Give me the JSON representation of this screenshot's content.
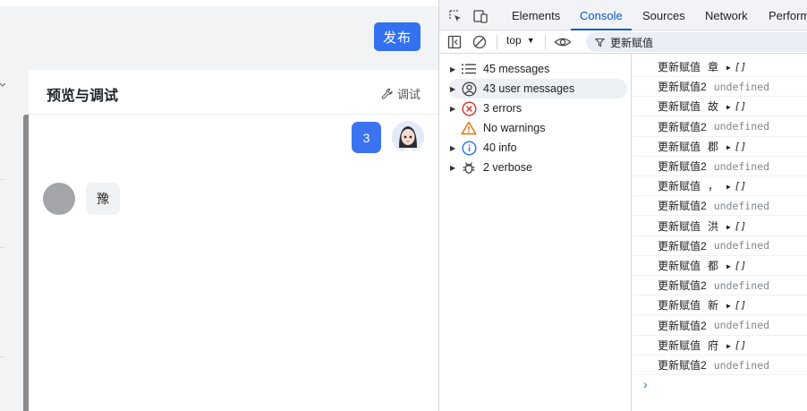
{
  "app": {
    "publish_label": "发布",
    "preview_title": "预览与调试",
    "debug_label": "调试",
    "user_message": "3",
    "bot_message": "豫"
  },
  "devtools": {
    "tabs": [
      "Elements",
      "Console",
      "Sources",
      "Network",
      "Perform"
    ],
    "active_tab": "Console",
    "context": "top",
    "filter_text": "更新赋值",
    "sidebar": [
      {
        "label": "45 messages",
        "icon": "list-icon",
        "expandable": true
      },
      {
        "label": "43 user messages",
        "icon": "user-circle-icon",
        "expandable": true,
        "selected": true
      },
      {
        "label": "3 errors",
        "icon": "error-icon",
        "expandable": true
      },
      {
        "label": "No warnings",
        "icon": "warning-icon",
        "expandable": false
      },
      {
        "label": "40 info",
        "icon": "info-icon",
        "expandable": true
      },
      {
        "label": "2 verbose",
        "icon": "bug-icon",
        "expandable": true
      }
    ],
    "logs": [
      {
        "label": "更新赋值",
        "char": "章",
        "value": "[]"
      },
      {
        "label": "更新赋值2",
        "value": "undefined"
      },
      {
        "label": "更新赋值",
        "char": "故",
        "value": "[]"
      },
      {
        "label": "更新赋值2",
        "value": "undefined"
      },
      {
        "label": "更新赋值",
        "char": "郡",
        "value": "[]"
      },
      {
        "label": "更新赋值2",
        "value": "undefined"
      },
      {
        "label": "更新赋值",
        "char": "，",
        "value": "[]"
      },
      {
        "label": "更新赋值2",
        "value": "undefined"
      },
      {
        "label": "更新赋值",
        "char": "洪",
        "value": "[]"
      },
      {
        "label": "更新赋值2",
        "value": "undefined"
      },
      {
        "label": "更新赋值",
        "char": "都",
        "value": "[]"
      },
      {
        "label": "更新赋值2",
        "value": "undefined"
      },
      {
        "label": "更新赋值",
        "char": "新",
        "value": "[]"
      },
      {
        "label": "更新赋值2",
        "value": "undefined"
      },
      {
        "label": "更新赋值",
        "char": "府",
        "value": "[]"
      },
      {
        "label": "更新赋值2",
        "value": "undefined"
      }
    ],
    "prompt": "›"
  },
  "colors": {
    "accent": "#3471f0",
    "devtools_active": "#0b57d0",
    "error": "#d93025",
    "warning": "#e37400",
    "info": "#1a73e8"
  }
}
